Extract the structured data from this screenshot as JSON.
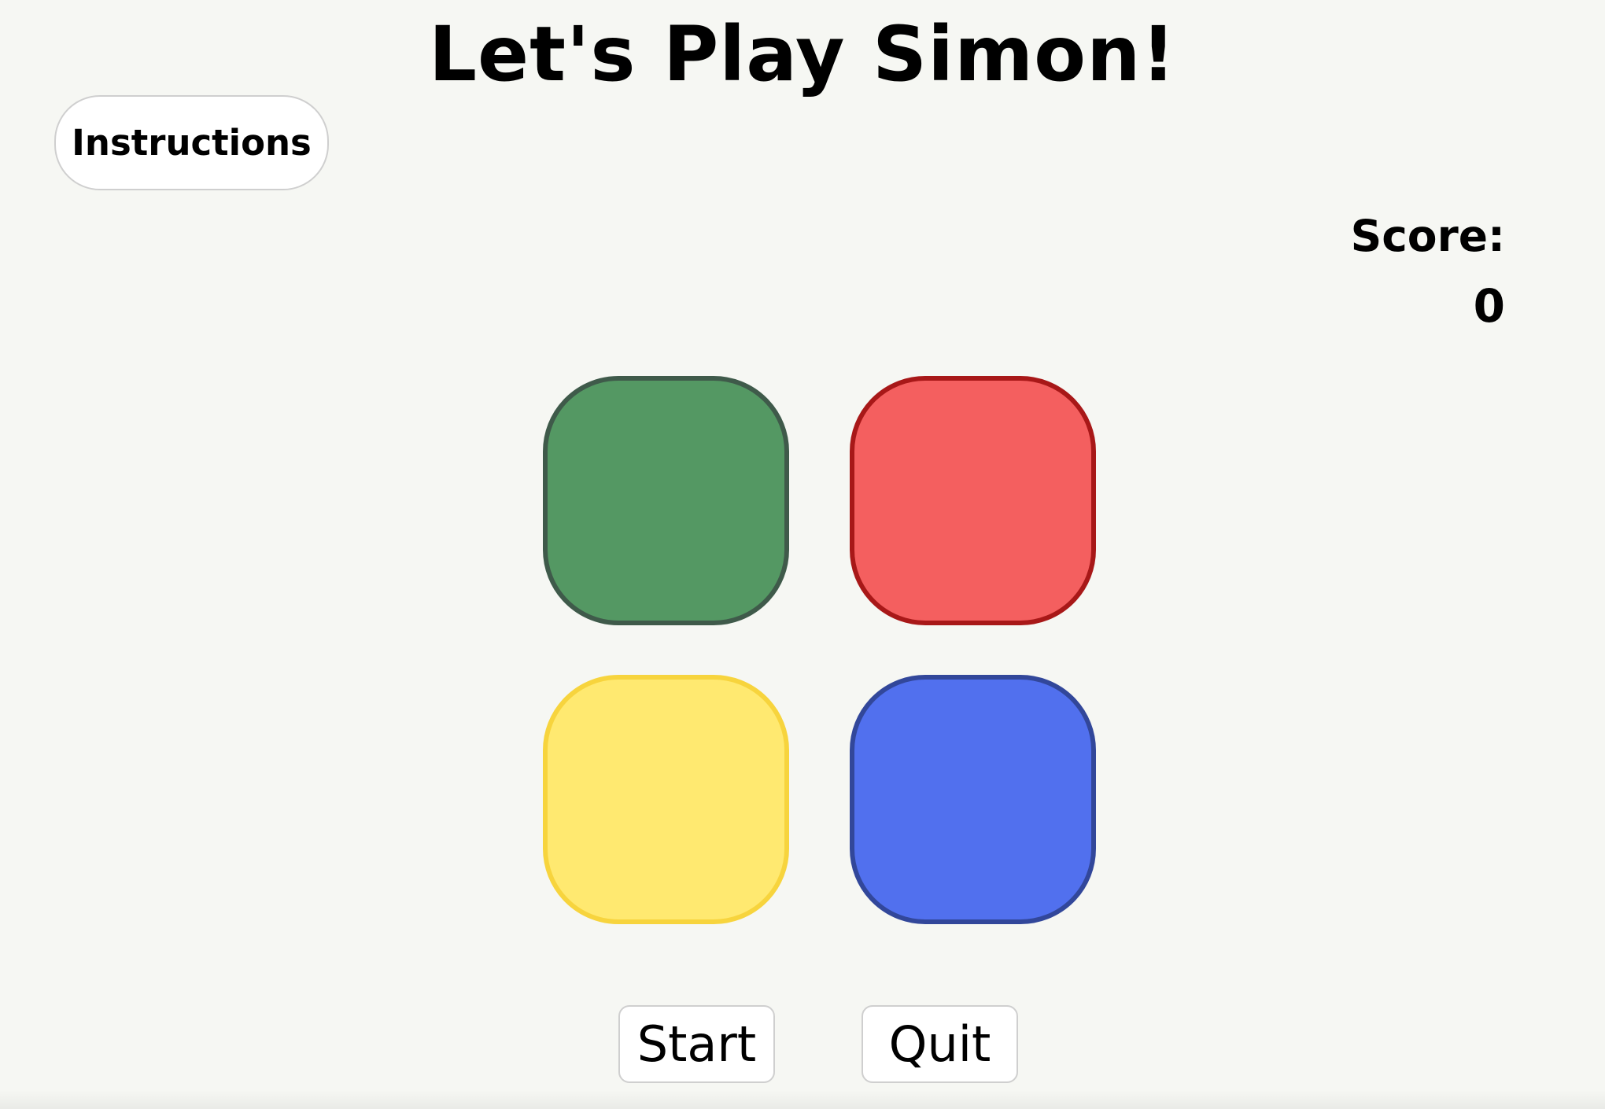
{
  "header": {
    "title": "Let's Play Simon!"
  },
  "instructions": {
    "label": "Instructions"
  },
  "score": {
    "label": "Score:",
    "value": "0"
  },
  "board": {
    "pads": [
      {
        "name": "green",
        "fill": "#549863",
        "border": "#3f5a4a"
      },
      {
        "name": "red",
        "fill": "#f45f5f",
        "border": "#a81818"
      },
      {
        "name": "yellow",
        "fill": "#ffe970",
        "border": "#f7d43d"
      },
      {
        "name": "blue",
        "fill": "#5170ee",
        "border": "#32479a"
      }
    ]
  },
  "controls": {
    "start_label": "Start",
    "quit_label": "Quit"
  }
}
